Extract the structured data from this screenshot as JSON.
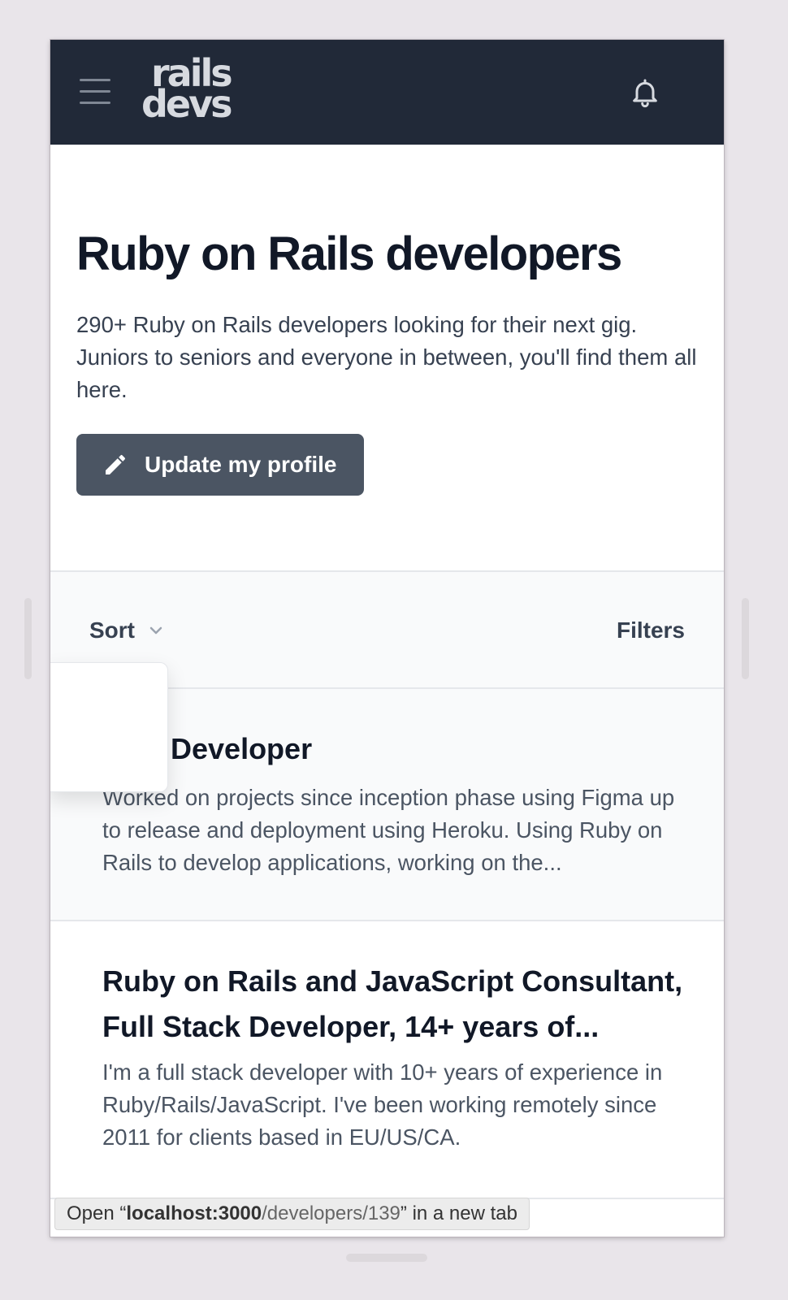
{
  "navbar": {
    "logo_line1": "rails",
    "logo_line2": "devs",
    "menu_icon": "hamburger-icon",
    "bell_icon": "bell-icon"
  },
  "hero": {
    "title": "Ruby on Rails developers",
    "description": "290+ Ruby on Rails developers looking for their next gig. Juniors to seniors and everyone in between, you'll find them all here.",
    "update_button_label": "Update my profile",
    "update_button_icon": "pencil-icon"
  },
  "toolbar": {
    "sort_label": "Sort",
    "filters_label": "Filters"
  },
  "developers": [
    {
      "title": "Developer",
      "description": "Worked on projects since inception phase using Figma up to release and deployment using Heroku. Using Ruby on Rails to develop applications, working on the..."
    },
    {
      "title": "Ruby on Rails and JavaScript Consultant, Full Stack Developer, 14+ years of...",
      "description": "I'm a full stack developer with 10+ years of experience in Ruby/Rails/JavaScript. I've been working remotely since 2011 for clients based in EU/US/CA."
    }
  ],
  "status_bar": {
    "prefix": "Open “",
    "host": "localhost:3000",
    "path": "/developers/139",
    "suffix": "” in a new tab"
  },
  "colors": {
    "navbar": "#212938",
    "button": "#4b5563",
    "text_dark": "#111827",
    "text_muted": "#4b5563"
  }
}
